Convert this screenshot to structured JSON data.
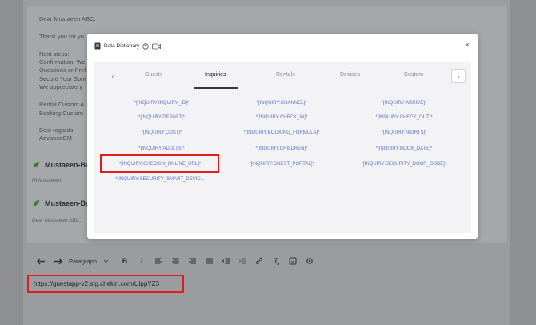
{
  "email": {
    "lines": [
      "Dear Mustaeen ABC,",
      "Thank you for yo",
      "Next steps:",
      "Confirmation: We",
      "Questions or Pref",
      "Secure Your Spot",
      "We appreciate y",
      "Rental Custom A",
      "Booking Custom",
      "Best regards,",
      "AdvanceCM"
    ],
    "replies": [
      {
        "author": "Mustaeen-Bas",
        "preview": "Hi Mustaeen"
      },
      {
        "author": "Mustaeen-Bas",
        "preview": "Dear Mustaeen ABC,"
      }
    ]
  },
  "toolbar": {
    "paragraph": "Paragraph",
    "bold": "B",
    "italic": "I"
  },
  "editor": {
    "content": "https://guestapp-v2.stg.chekin.com/UlppYZ3"
  },
  "modal": {
    "title": "Data Dictionary",
    "close": "×",
    "tabs": [
      "Guests",
      "Inquiries",
      "Rentals",
      "Devices",
      "Custom"
    ],
    "active_tab": "Inquiries",
    "tokens": [
      [
        "*[INQUIRY:INQUIRY_ID]*",
        "*[INQUIRY:CHANNEL]*",
        "*[INQUIRY:ARRIVE]*"
      ],
      [
        "*[INQUIRY:DEPART]*",
        "*[INQUIRY:CHECK_IN]*",
        "*[INQUIRY:CHECK_OUT]*"
      ],
      [
        "*[INQUIRY:COST]*",
        "*[INQUIRY:BOOKING_FORMULA]*",
        "*[INQUIRY:NIGHTS]*"
      ],
      [
        "*[INQUIRY:ADULTS]*",
        "*[INQUIRY:CHILDREN]*",
        "*[INQUIRY:BOOK_DATE]*"
      ],
      [
        "*[INQUIRY:CHECKIN_ONLINE_URL]*",
        "*[INQUIRY:GUEST_PORTAL]*",
        "*[INQUIRY:SECURITY_DOOR_CODE]*"
      ],
      [
        "*[INQUIRY:SECURITY_SMART_DEVIC..."
      ]
    ]
  },
  "colors": {
    "token": "#5b74c9",
    "highlight": "#e01d1d",
    "tab_active_underline": "#2f3a4a"
  }
}
